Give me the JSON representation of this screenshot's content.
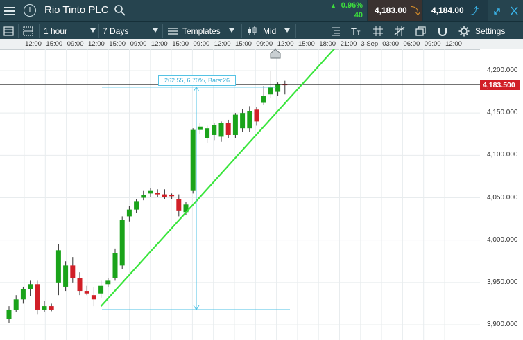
{
  "header": {
    "title": "Rio Tinto PLC",
    "change_percent": "0.96%",
    "change_points": "40",
    "sell_price": "4,183.00",
    "buy_price": "4,184.00",
    "colors": {
      "up": "#3ddc3d",
      "sell_bg": "#3a3230",
      "buy_bg": "#1f3a46",
      "bar_bg": "#26444f"
    }
  },
  "toolbar": {
    "interval": "1 hour",
    "range": "7 Days",
    "templates_label": "Templates",
    "price_type": "Mid",
    "settings_label": "Settings",
    "icons": [
      "layout-icon",
      "grid-icon",
      "text-tool-icon",
      "crosshair-icon",
      "drawing-tool-icon",
      "windows-icon",
      "magnet-icon",
      "gear-icon"
    ]
  },
  "time_axis": {
    "labels": [
      "12:00",
      "15:00",
      "09:00",
      "12:00",
      "15:00",
      "09:00",
      "12:00",
      "15:00",
      "09:00",
      "12:00",
      "15:00",
      "09:00",
      "12:00",
      "15:00",
      "18:00",
      "21:00",
      "3 Sep",
      "03:00",
      "06:00",
      "09:00",
      "12:00"
    ]
  },
  "price_axis": {
    "labels": [
      "4,200.000",
      "4,150.000",
      "4,100.000",
      "4,050.000",
      "4,000.000",
      "3,950.000",
      "3,900.000"
    ],
    "last_price": "4,183.500"
  },
  "chart_data": {
    "type": "candlestick",
    "up_color": "#1aa31a",
    "down_color": "#d11f27",
    "last_price": 4183.5,
    "candles": [
      {
        "o": 3907,
        "h": 3922,
        "l": 3902,
        "c": 3918
      },
      {
        "o": 3918,
        "h": 3935,
        "l": 3915,
        "c": 3930
      },
      {
        "o": 3930,
        "h": 3945,
        "l": 3925,
        "c": 3942
      },
      {
        "o": 3942,
        "h": 3952,
        "l": 3934,
        "c": 3948
      },
      {
        "o": 3948,
        "h": 3952,
        "l": 3912,
        "c": 3918
      },
      {
        "o": 3918,
        "h": 3928,
        "l": 3915,
        "c": 3922
      },
      {
        "o": 3922,
        "h": 3925,
        "l": 3916,
        "c": 3918
      },
      {
        "o": 3950,
        "h": 3995,
        "l": 3935,
        "c": 3988
      },
      {
        "o": 3945,
        "h": 3975,
        "l": 3940,
        "c": 3970
      },
      {
        "o": 3970,
        "h": 3980,
        "l": 3950,
        "c": 3955
      },
      {
        "o": 3955,
        "h": 3962,
        "l": 3935,
        "c": 3940
      },
      {
        "o": 3940,
        "h": 3946,
        "l": 3935,
        "c": 3937
      },
      {
        "o": 3935,
        "h": 3945,
        "l": 3922,
        "c": 3930
      },
      {
        "o": 3937,
        "h": 3952,
        "l": 3932,
        "c": 3946
      },
      {
        "o": 3948,
        "h": 3955,
        "l": 3945,
        "c": 3952
      },
      {
        "o": 3955,
        "h": 3990,
        "l": 3952,
        "c": 3985
      },
      {
        "o": 3970,
        "h": 4028,
        "l": 3966,
        "c": 4024
      },
      {
        "o": 4028,
        "h": 4040,
        "l": 4022,
        "c": 4036
      },
      {
        "o": 4036,
        "h": 4048,
        "l": 4032,
        "c": 4046
      },
      {
        "o": 4050,
        "h": 4058,
        "l": 4047,
        "c": 4053
      },
      {
        "o": 4055,
        "h": 4061,
        "l": 4051,
        "c": 4058
      },
      {
        "o": 4056,
        "h": 4060,
        "l": 4051,
        "c": 4054
      },
      {
        "o": 4054,
        "h": 4060,
        "l": 4048,
        "c": 4051
      },
      {
        "o": 4053,
        "h": 4055,
        "l": 4048,
        "c": 4052
      },
      {
        "o": 4048,
        "h": 4054,
        "l": 4028,
        "c": 4035
      },
      {
        "o": 4033,
        "h": 4045,
        "l": 4030,
        "c": 4042
      },
      {
        "o": 4058,
        "h": 4132,
        "l": 4055,
        "c": 4130
      },
      {
        "o": 4130,
        "h": 4138,
        "l": 4125,
        "c": 4134
      },
      {
        "o": 4120,
        "h": 4135,
        "l": 4115,
        "c": 4132
      },
      {
        "o": 4124,
        "h": 4138,
        "l": 4118,
        "c": 4136
      },
      {
        "o": 4122,
        "h": 4140,
        "l": 4116,
        "c": 4138
      },
      {
        "o": 4138,
        "h": 4142,
        "l": 4120,
        "c": 4124
      },
      {
        "o": 4124,
        "h": 4150,
        "l": 4120,
        "c": 4148
      },
      {
        "o": 4132,
        "h": 4155,
        "l": 4128,
        "c": 4150
      },
      {
        "o": 4132,
        "h": 4158,
        "l": 4128,
        "c": 4152
      },
      {
        "o": 4154,
        "h": 4157,
        "l": 4135,
        "c": 4140
      },
      {
        "o": 4162,
        "h": 4182,
        "l": 4160,
        "c": 4170
      },
      {
        "o": 4172,
        "h": 4200,
        "l": 4168,
        "c": 4180
      },
      {
        "o": 4175,
        "h": 4186,
        "l": 4170,
        "c": 4184
      },
      {
        "o": 4184,
        "h": 4188,
        "l": 4172,
        "c": 4183
      }
    ],
    "trendline": {
      "start": {
        "bar": 13,
        "price": 3922
      },
      "end": {
        "bar": 46,
        "price": 4226
      }
    },
    "measure": {
      "label": "262.55, 6.70%, Bars:26",
      "top_price": 4180.5,
      "bottom_price": 3918
    },
    "ylim": [
      3895,
      4218
    ],
    "grid": true
  }
}
